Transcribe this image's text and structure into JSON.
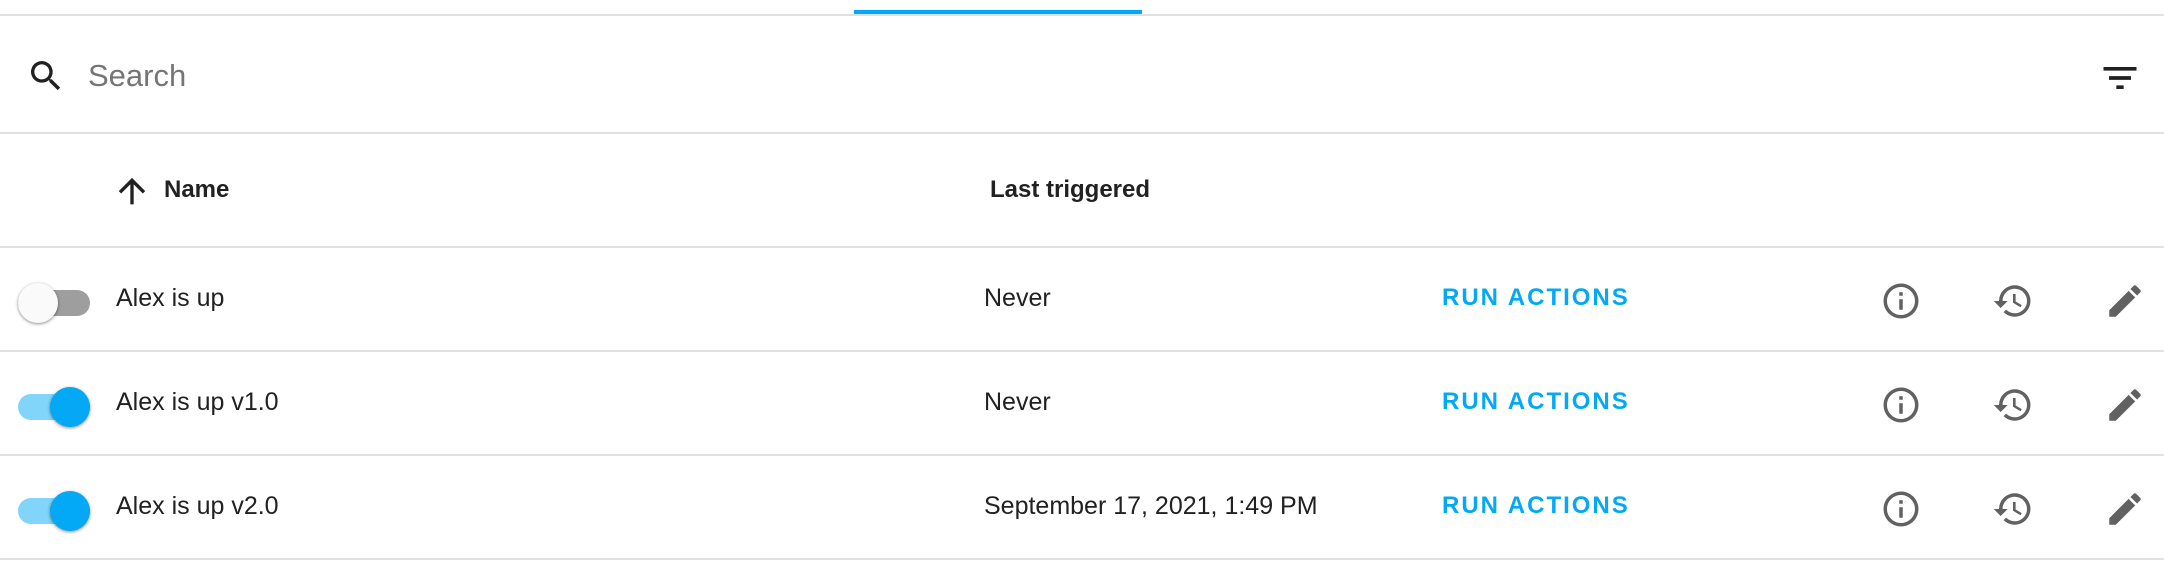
{
  "search": {
    "placeholder": "Search",
    "value": ""
  },
  "icons": {
    "search": "search-icon",
    "filter": "filter-icon",
    "sort": "arrow-up-icon",
    "info": "info-icon",
    "history": "history-icon",
    "edit": "pencil-icon"
  },
  "colors": {
    "accent": "#03a9f4",
    "toggle_on_track": "#81d4fa",
    "toggle_off_track": "#9e9e9e",
    "divider": "#e0e0e0"
  },
  "table": {
    "columns": {
      "name": "Name",
      "last_triggered": "Last triggered"
    },
    "rows": [
      {
        "enabled": false,
        "name": "Alex is up",
        "last_triggered": "Never",
        "action": "RUN ACTIONS"
      },
      {
        "enabled": true,
        "name": "Alex is up v1.0",
        "last_triggered": "Never",
        "action": "RUN ACTIONS"
      },
      {
        "enabled": true,
        "name": "Alex is up v2.0",
        "last_triggered": "September 17, 2021, 1:49 PM",
        "action": "RUN ACTIONS"
      }
    ]
  }
}
